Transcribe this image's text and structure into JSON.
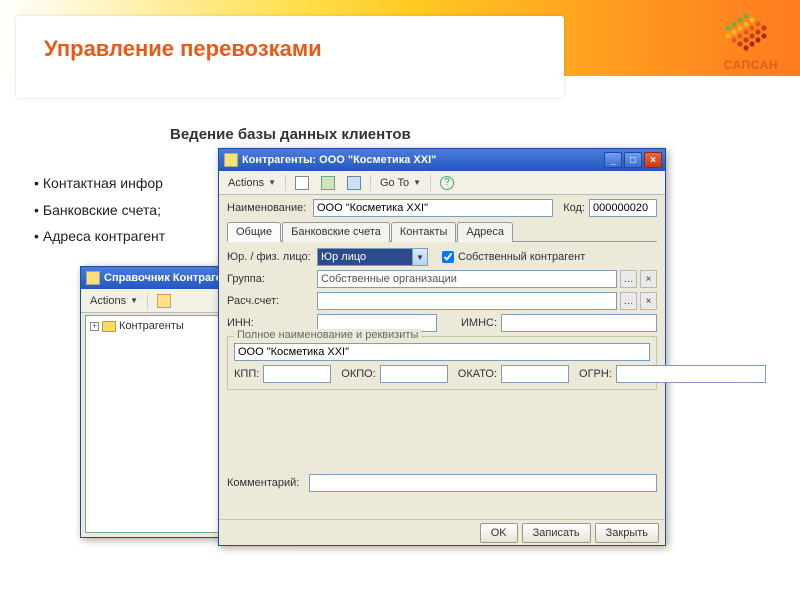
{
  "presentation": {
    "brand": "САПСАН",
    "title": "Управление перевозками",
    "subtitle": "Ведение базы данных клиентов",
    "bullets": [
      "Контактная инфор",
      "Банковские счета;",
      "Адреса контрагент"
    ]
  },
  "browser": {
    "title": "Справочник Контрагент",
    "toolbar": {
      "actions": "Actions"
    },
    "tree_root": "Контрагенты"
  },
  "card": {
    "title": "Контрагенты: ООО \"Косметика XXI\"",
    "toolbar": {
      "actions": "Actions",
      "goto": "Go To"
    },
    "fields": {
      "name_label": "Наименование:",
      "name_value": "ООО \"Косметика XXI\"",
      "code_label": "Код:",
      "code_value": "000000020",
      "entity_label": "Юр. / физ. лицо:",
      "entity_value": "Юр лицо",
      "own_checkbox_label": "Собственный контрагент",
      "own_checked": true,
      "group_label": "Группа:",
      "group_value": "Собственные организации",
      "account_label": "Расч.счет:",
      "account_value": "",
      "inn_label": "ИНН:",
      "inn_value": "",
      "imns_label": "ИМНС:",
      "imns_value": "",
      "fullname_group": "Полное наименование и реквизиты",
      "fullname_value": "ООО \"Косметика XXI\"",
      "kpp_label": "КПП:",
      "kpp_value": "",
      "okpo_label": "ОКПО:",
      "okpo_value": "",
      "okato_label": "ОКАТО:",
      "okato_value": "",
      "ogrn_label": "ОГРН:",
      "ogrn_value": "",
      "comment_label": "Комментарий:",
      "comment_value": ""
    },
    "tabs": [
      "Общие",
      "Банковские счета",
      "Контакты",
      "Адреса"
    ],
    "buttons": {
      "ok": "OK",
      "save": "Записать",
      "close": "Закрыть"
    }
  }
}
